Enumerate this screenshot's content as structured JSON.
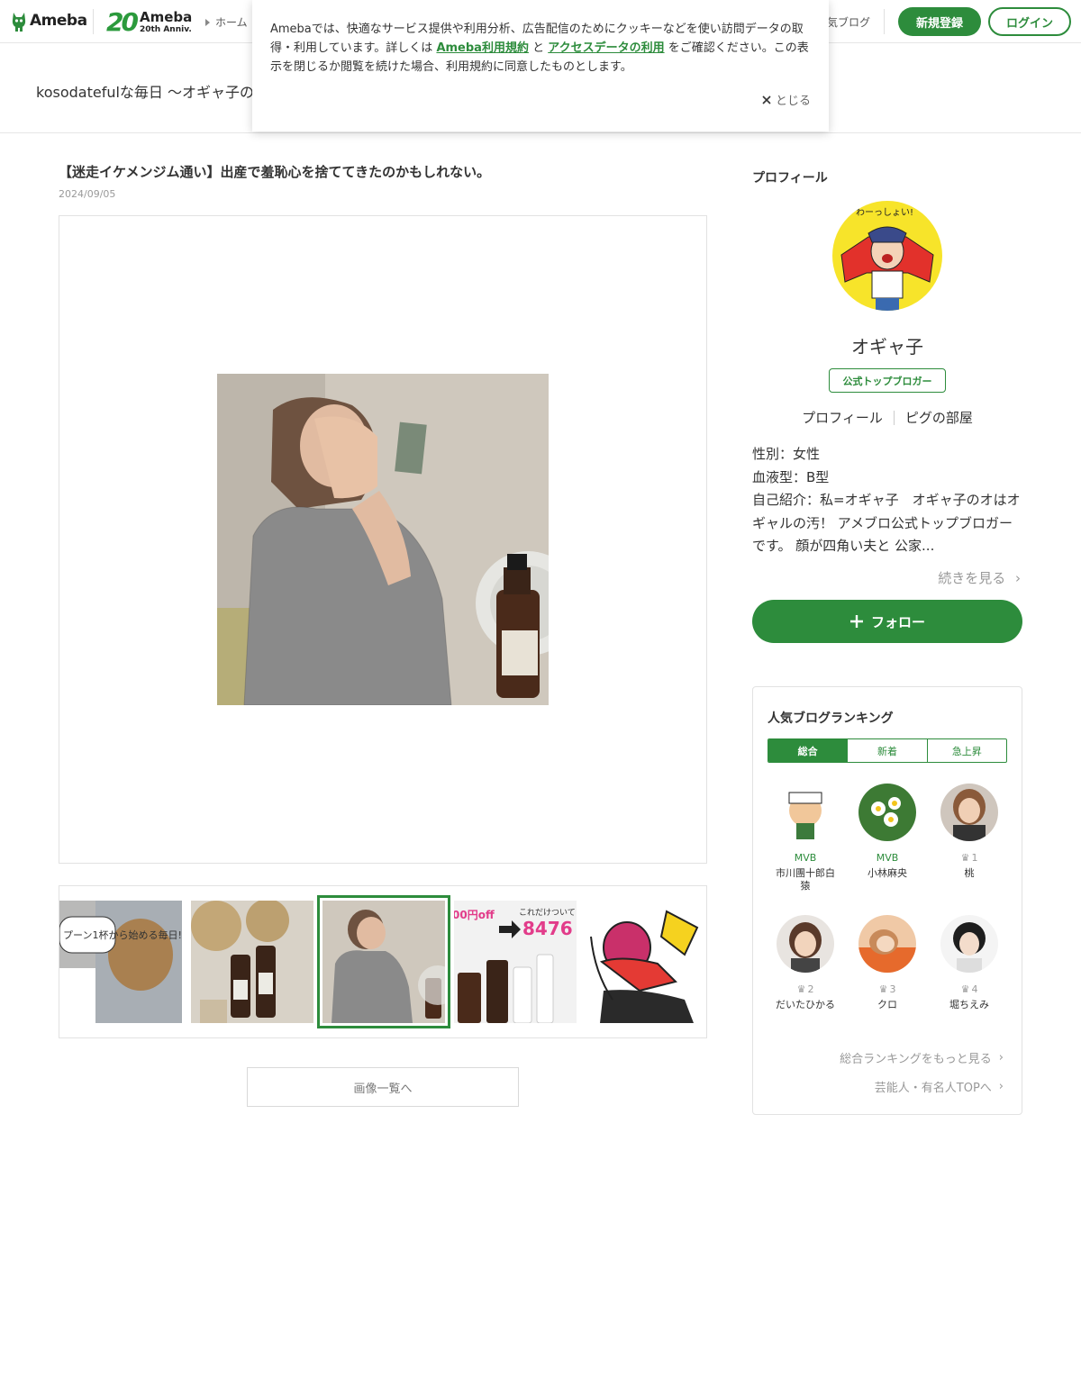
{
  "header": {
    "logo_text": "Ameba",
    "anniv_num": "20",
    "anniv_line1": "Ameba",
    "anniv_line2": "20th Anniv.",
    "home_link": "ホーム",
    "popular_blog_link": "気ブログ",
    "register_label": "新規登録",
    "login_label": "ログイン"
  },
  "blog": {
    "title": "kosodatefulな毎日 〜オギャ子の"
  },
  "cookie": {
    "text_before": "Amebaでは、快適なサービス提供や利用分析、広告配信のためにクッキーなどを使い訪問データの取得・利用しています。詳しくは ",
    "link1": "Ameba利用規約",
    "text_mid": " と ",
    "link2": "アクセスデータの利用",
    "text_after": " をご確認ください。この表示を閉じるか閲覧を続けた場合、利用規約に同意したものとします。",
    "close_label": "とじる"
  },
  "article": {
    "title": "【迷走イケメンジム通い】出産で羞恥心を捨ててきたのかもしれない。",
    "date": "2024/09/05",
    "image_list_button": "画像一覧へ",
    "thumb_texts": {
      "t1": "プーン1杯から始める毎日!",
      "t4a": "00円off",
      "t4b": "これだけついて",
      "t4c": "8476"
    }
  },
  "profile": {
    "heading": "プロフィール",
    "name": "オギャ子",
    "badge": "公式トップブロガー",
    "link_profile": "プロフィール",
    "link_room": "ピグの部屋",
    "gender": "性別：女性",
    "blood": "血液型：B型",
    "intro": "自己紹介：私=オギャ子　オギャ子のオはオギャルの汚！ アメブロ公式トップブロガーです。 顔が四角い夫と 公家...",
    "more_label": "続きを見る",
    "follow_label": "フォロー",
    "avatar_text": "わーっしょい!"
  },
  "ranking": {
    "heading": "人気ブログランキング",
    "tabs": [
      "総合",
      "新着",
      "急上昇"
    ],
    "items": [
      {
        "label": "MVB",
        "name": "市川團十郎白猿"
      },
      {
        "label": "MVB",
        "name": "小林麻央"
      },
      {
        "label": "1",
        "name": "桃"
      },
      {
        "label": "2",
        "name": "だいたひかる"
      },
      {
        "label": "3",
        "name": "クロ"
      },
      {
        "label": "4",
        "name": "堀ちえみ"
      }
    ],
    "more_ranking": "総合ランキングをもっと見る",
    "celeb_top": "芸能人・有名人TOPへ"
  },
  "colors": {
    "brand_green": "#2d8c3c"
  }
}
